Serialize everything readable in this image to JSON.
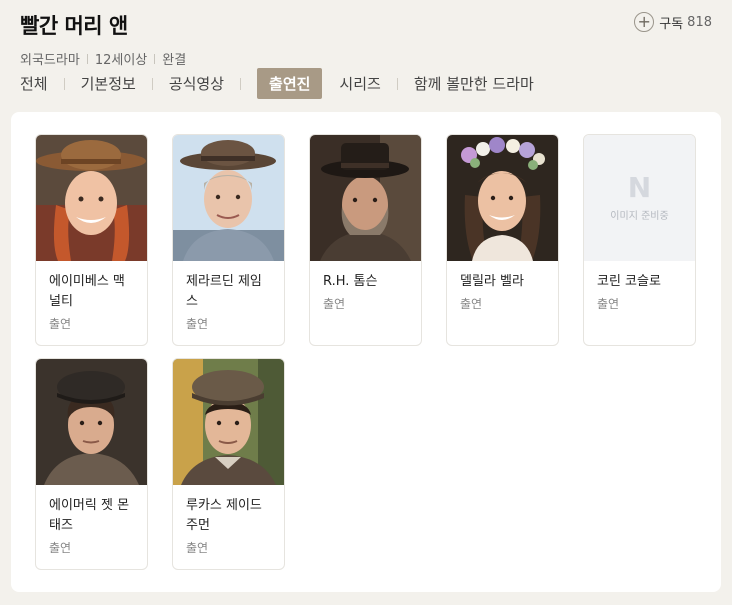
{
  "header": {
    "title": "빨간 머리 앤",
    "meta": [
      "외국드라마",
      "12세이상",
      "완결"
    ],
    "subscribe_label": "구독",
    "subscribe_count": "818"
  },
  "tabs": [
    {
      "label": "전체",
      "active": false
    },
    {
      "label": "기본정보",
      "active": false
    },
    {
      "label": "공식영상",
      "active": false
    },
    {
      "label": "출연진",
      "active": true
    },
    {
      "label": "시리즈",
      "active": false
    },
    {
      "label": "함께 볼만한 드라마",
      "active": false
    }
  ],
  "cast": [
    {
      "name": "에이미베스 맥널티",
      "role": "출연",
      "photo": "photo-hat-redhair"
    },
    {
      "name": "제라르딘 제임스",
      "role": "출연",
      "photo": "photo-hat-elderly"
    },
    {
      "name": "R.H. 톰슨",
      "role": "출연",
      "photo": "photo-hat-dark"
    },
    {
      "name": "델릴라 벨라",
      "role": "출연",
      "photo": "photo-flower-crown"
    },
    {
      "name": "코린 코슬로",
      "role": "출연",
      "photo": "placeholder",
      "placeholder_logo": "N",
      "placeholder_text": "이미지 준비중"
    },
    {
      "name": "에이머릭 젯 몬태즈",
      "role": "출연",
      "photo": "photo-cap-dark"
    },
    {
      "name": "루카스 제이드 주먼",
      "role": "출연",
      "photo": "photo-cap-outdoor"
    }
  ]
}
